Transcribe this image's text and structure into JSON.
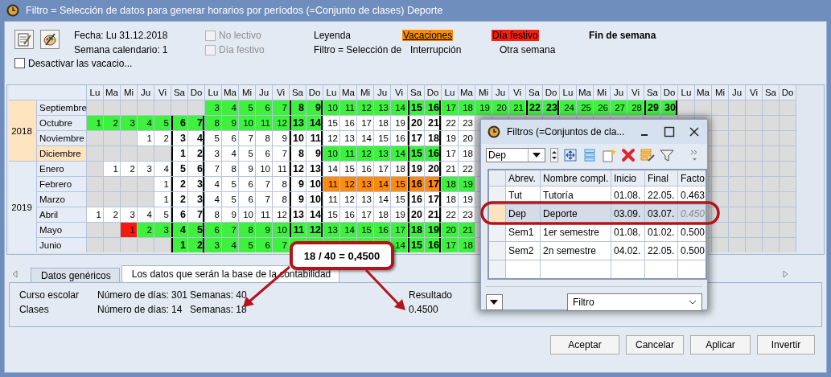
{
  "window": {
    "title": "Filtro = Selección de datos para generar horarios por períodos (=Conjunto de clases) Deporte"
  },
  "header": {
    "date_label": "Fecha:",
    "date": "Lu 31.12.2018",
    "week_label": "Semana calendario:",
    "week": "1",
    "options": [
      {
        "label": "No lectivo",
        "checked": false,
        "disabled": true
      },
      {
        "label": "Día festivo",
        "checked": false,
        "disabled": true
      }
    ],
    "legend_label": "Leyenda",
    "legend": [
      {
        "label": "Vacaciones",
        "kind": "vacation"
      },
      {
        "label": "Día festivo",
        "kind": "holiday"
      },
      {
        "label": "Fin de semana",
        "kind": "weekend"
      }
    ],
    "filter_label": "Filtro = Selección de",
    "legend_more": [
      "Interrupción",
      "Otra semana"
    ],
    "deactivate": {
      "label": "Desactivar las vacacio...",
      "checked": false
    }
  },
  "calendar": {
    "weekdays": [
      "Lu",
      "Ma",
      "Mi",
      "Ju",
      "Vi",
      "Sa",
      "Do",
      "Lu",
      "Ma",
      "Mi",
      "Ju",
      "Vi",
      "Sa",
      "Do",
      "Lu",
      "Ma",
      "Mi",
      "Ju",
      "Vi",
      "Sa",
      "Do",
      "Lu",
      "Ma",
      "Mi",
      "Ju",
      "Vi",
      "Sa",
      "Do",
      "Lu",
      "Ma",
      "Mi",
      "Ju",
      "Vi",
      "Sa",
      "Do",
      "Lu",
      "Ma",
      "Mi",
      "Ju",
      "Vi",
      "Sa",
      "Do"
    ],
    "years": [
      {
        "year": "2018",
        "selected": true,
        "months": [
          {
            "name": "Septiembre",
            "selected": false,
            "cells": [
              {
                "kind": "empty"
              },
              {
                "kind": "empty"
              },
              {
                "kind": "empty"
              },
              {
                "kind": "empty"
              },
              {
                "kind": "empty"
              },
              {
                "kind": "empty"
              },
              {
                "kind": "empty"
              },
              {
                "day": "3",
                "kind": "filter"
              },
              {
                "day": "4",
                "kind": "filter"
              },
              {
                "day": "5",
                "kind": "filter"
              },
              {
                "day": "6",
                "kind": "filter"
              },
              {
                "day": "7",
                "kind": "filter"
              },
              {
                "day": "8",
                "kind": "filter"
              },
              {
                "day": "9",
                "kind": "filter"
              },
              {
                "day": "10",
                "kind": "filter"
              },
              {
                "day": "11",
                "kind": "filter"
              },
              {
                "day": "12",
                "kind": "filter"
              },
              {
                "day": "13",
                "kind": "filter"
              },
              {
                "day": "14",
                "kind": "filter"
              },
              {
                "day": "15",
                "kind": "filter"
              },
              {
                "day": "16",
                "kind": "filter"
              },
              {
                "day": "17",
                "kind": "filter"
              },
              {
                "day": "18",
                "kind": "filter"
              },
              {
                "day": "19",
                "kind": "filter"
              },
              {
                "day": "20",
                "kind": "filter"
              },
              {
                "day": "21",
                "kind": "filter"
              },
              {
                "day": "22",
                "kind": "filter"
              },
              {
                "day": "23",
                "kind": "filter"
              },
              {
                "day": "24",
                "kind": "filter"
              },
              {
                "day": "25",
                "kind": "filter"
              },
              {
                "day": "26",
                "kind": "filter"
              },
              {
                "day": "27",
                "kind": "filter"
              },
              {
                "day": "28",
                "kind": "filter"
              },
              {
                "day": "29",
                "kind": "filter"
              },
              {
                "day": "30",
                "kind": "filter"
              },
              {
                "kind": "empty"
              },
              {
                "kind": "empty"
              },
              {
                "kind": "empty"
              },
              {
                "kind": "empty"
              },
              {
                "kind": "empty"
              },
              {
                "kind": "empty"
              },
              {
                "kind": "empty"
              }
            ]
          },
          {
            "name": "Octubre",
            "selected": false,
            "cells": [
              {
                "day": "1",
                "kind": "filter"
              },
              {
                "day": "2",
                "kind": "filter"
              },
              {
                "day": "3",
                "kind": "filter"
              },
              {
                "day": "4",
                "kind": "filter"
              },
              {
                "day": "5",
                "kind": "filter"
              },
              {
                "day": "6",
                "kind": "filter"
              },
              {
                "day": "7",
                "kind": "filter"
              },
              {
                "day": "8",
                "kind": "filter"
              },
              {
                "day": "9",
                "kind": "filter"
              },
              {
                "day": "10",
                "kind": "filter"
              },
              {
                "day": "11",
                "kind": "filter"
              },
              {
                "day": "12",
                "kind": "filter"
              },
              {
                "day": "13",
                "kind": "filter"
              },
              {
                "day": "14",
                "kind": "filter"
              },
              {
                "day": "15",
                "kind": "school"
              },
              {
                "day": "16",
                "kind": "school"
              },
              {
                "day": "17",
                "kind": "school"
              },
              {
                "day": "18",
                "kind": "school"
              },
              {
                "day": "19",
                "kind": "school"
              },
              {
                "day": "20",
                "kind": "school"
              },
              {
                "day": "21",
                "kind": "school"
              },
              {
                "day": "22",
                "kind": "school"
              },
              {
                "day": "23",
                "kind": "school"
              }
            ],
            "trailing_cells": [
              {
                "kind": "empty"
              },
              {
                "kind": "empty"
              },
              {
                "kind": "empty"
              },
              {
                "kind": "empty"
              },
              {
                "kind": "empty"
              }
            ]
          },
          {
            "name": "Noviembre",
            "selected": false,
            "cells": [
              {
                "kind": "empty"
              },
              {
                "kind": "empty"
              },
              {
                "kind": "empty"
              },
              {
                "day": "1",
                "kind": "school"
              },
              {
                "day": "2",
                "kind": "school"
              },
              {
                "day": "3",
                "kind": "school"
              },
              {
                "day": "4",
                "kind": "school"
              },
              {
                "day": "5",
                "kind": "school"
              },
              {
                "day": "6",
                "kind": "school"
              },
              {
                "day": "7",
                "kind": "school"
              },
              {
                "day": "8",
                "kind": "school"
              },
              {
                "day": "9",
                "kind": "school"
              },
              {
                "day": "10",
                "kind": "school"
              },
              {
                "day": "11",
                "kind": "school"
              },
              {
                "day": "12",
                "kind": "school"
              },
              {
                "day": "13",
                "kind": "school"
              },
              {
                "day": "14",
                "kind": "school"
              },
              {
                "day": "15",
                "kind": "school"
              },
              {
                "day": "16",
                "kind": "school"
              },
              {
                "day": "17",
                "kind": "school"
              },
              {
                "day": "18",
                "kind": "school"
              },
              {
                "day": "19",
                "kind": "school"
              },
              {
                "day": "20",
                "kind": "school"
              }
            ],
            "trailing_cells": [
              {
                "kind": "empty"
              },
              {
                "kind": "empty"
              },
              {
                "kind": "empty"
              },
              {
                "kind": "empty"
              },
              {
                "kind": "empty"
              }
            ]
          },
          {
            "name": "Diciembre",
            "selected": true,
            "cells": [
              {
                "kind": "empty"
              },
              {
                "kind": "empty"
              },
              {
                "kind": "empty"
              },
              {
                "kind": "empty"
              },
              {
                "kind": "empty"
              },
              {
                "day": "1",
                "kind": "school"
              },
              {
                "day": "2",
                "kind": "school"
              },
              {
                "day": "3",
                "kind": "school"
              },
              {
                "day": "4",
                "kind": "school"
              },
              {
                "day": "5",
                "kind": "school"
              },
              {
                "day": "6",
                "kind": "school"
              },
              {
                "day": "7",
                "kind": "school"
              },
              {
                "day": "8",
                "kind": "school"
              },
              {
                "day": "9",
                "kind": "school"
              },
              {
                "day": "10",
                "kind": "filter"
              },
              {
                "day": "11",
                "kind": "filter"
              },
              {
                "day": "12",
                "kind": "filter"
              },
              {
                "day": "13",
                "kind": "filter"
              },
              {
                "day": "14",
                "kind": "filter"
              },
              {
                "day": "15",
                "kind": "filter"
              },
              {
                "day": "16",
                "kind": "filter"
              },
              {
                "day": "17",
                "kind": "school"
              },
              {
                "day": "18",
                "kind": "school"
              }
            ],
            "trailing_cells": [
              {
                "kind": "empty"
              },
              {
                "kind": "empty"
              },
              {
                "kind": "empty"
              },
              {
                "kind": "empty"
              },
              {
                "kind": "empty"
              }
            ]
          }
        ]
      },
      {
        "year": "2019",
        "selected": false,
        "months": [
          {
            "name": "Enero",
            "selected": false,
            "cells": [
              {
                "kind": "empty"
              },
              {
                "day": "1",
                "kind": "school"
              },
              {
                "day": "2",
                "kind": "school"
              },
              {
                "day": "3",
                "kind": "school"
              },
              {
                "day": "4",
                "kind": "school"
              },
              {
                "day": "5",
                "kind": "school"
              },
              {
                "day": "6",
                "kind": "school"
              },
              {
                "day": "7",
                "kind": "school"
              },
              {
                "day": "8",
                "kind": "school"
              },
              {
                "day": "9",
                "kind": "school"
              },
              {
                "day": "10",
                "kind": "school"
              },
              {
                "day": "11",
                "kind": "school"
              },
              {
                "day": "12",
                "kind": "school"
              },
              {
                "day": "13",
                "kind": "school"
              },
              {
                "day": "14",
                "kind": "school"
              },
              {
                "day": "15",
                "kind": "school"
              },
              {
                "day": "16",
                "kind": "school"
              },
              {
                "day": "17",
                "kind": "school"
              },
              {
                "day": "18",
                "kind": "school"
              },
              {
                "day": "19",
                "kind": "school"
              },
              {
                "day": "20",
                "kind": "school"
              },
              {
                "day": "21",
                "kind": "school"
              },
              {
                "day": "22",
                "kind": "school"
              }
            ],
            "trailing_cells": [
              {
                "kind": "empty"
              },
              {
                "kind": "empty"
              },
              {
                "kind": "empty"
              },
              {
                "kind": "empty"
              },
              {
                "kind": "empty"
              }
            ]
          },
          {
            "name": "Febrero",
            "selected": false,
            "cells": [
              {
                "kind": "empty"
              },
              {
                "kind": "empty"
              },
              {
                "kind": "empty"
              },
              {
                "kind": "empty"
              },
              {
                "day": "1",
                "kind": "school"
              },
              {
                "day": "2",
                "kind": "school"
              },
              {
                "day": "3",
                "kind": "school"
              },
              {
                "day": "4",
                "kind": "school"
              },
              {
                "day": "5",
                "kind": "school"
              },
              {
                "day": "6",
                "kind": "school"
              },
              {
                "day": "7",
                "kind": "school"
              },
              {
                "day": "8",
                "kind": "school"
              },
              {
                "day": "9",
                "kind": "school"
              },
              {
                "day": "10",
                "kind": "school"
              },
              {
                "day": "11",
                "kind": "vacation"
              },
              {
                "day": "12",
                "kind": "vacation"
              },
              {
                "day": "13",
                "kind": "vacation"
              },
              {
                "day": "14",
                "kind": "vacation"
              },
              {
                "day": "15",
                "kind": "vacation"
              },
              {
                "day": "16",
                "kind": "vacation"
              },
              {
                "day": "17",
                "kind": "vacation"
              },
              {
                "day": "18",
                "kind": "filter"
              },
              {
                "day": "19",
                "kind": "filter"
              }
            ],
            "trailing_cells": [
              {
                "kind": "empty"
              },
              {
                "kind": "empty"
              },
              {
                "kind": "empty"
              },
              {
                "kind": "empty"
              },
              {
                "kind": "empty"
              }
            ]
          },
          {
            "name": "Marzo",
            "selected": false,
            "cells": [
              {
                "kind": "empty"
              },
              {
                "kind": "empty"
              },
              {
                "kind": "empty"
              },
              {
                "kind": "empty"
              },
              {
                "day": "1",
                "kind": "school"
              },
              {
                "day": "2",
                "kind": "school"
              },
              {
                "day": "3",
                "kind": "school"
              },
              {
                "day": "4",
                "kind": "school"
              },
              {
                "day": "5",
                "kind": "school"
              },
              {
                "day": "6",
                "kind": "school"
              },
              {
                "day": "7",
                "kind": "school"
              },
              {
                "day": "8",
                "kind": "school"
              },
              {
                "day": "9",
                "kind": "school"
              },
              {
                "day": "10",
                "kind": "school"
              },
              {
                "day": "11",
                "kind": "school"
              },
              {
                "day": "12",
                "kind": "school"
              },
              {
                "day": "13",
                "kind": "school"
              },
              {
                "day": "14",
                "kind": "school"
              },
              {
                "day": "15",
                "kind": "school"
              },
              {
                "day": "16",
                "kind": "school"
              },
              {
                "day": "17",
                "kind": "school"
              },
              {
                "day": "18",
                "kind": "school"
              },
              {
                "day": "19",
                "kind": "school"
              }
            ],
            "trailing_cells": [
              {
                "kind": "empty"
              },
              {
                "kind": "empty"
              },
              {
                "kind": "empty"
              },
              {
                "kind": "empty"
              },
              {
                "kind": "empty"
              }
            ]
          },
          {
            "name": "Abril",
            "selected": false,
            "cells": [
              {
                "day": "1",
                "kind": "school"
              },
              {
                "day": "2",
                "kind": "school"
              },
              {
                "day": "3",
                "kind": "school"
              },
              {
                "day": "4",
                "kind": "school"
              },
              {
                "day": "5",
                "kind": "school"
              },
              {
                "day": "6",
                "kind": "school"
              },
              {
                "day": "7",
                "kind": "school"
              },
              {
                "day": "8",
                "kind": "school"
              },
              {
                "day": "9",
                "kind": "school"
              },
              {
                "day": "10",
                "kind": "school"
              },
              {
                "day": "11",
                "kind": "school"
              },
              {
                "day": "12",
                "kind": "school"
              },
              {
                "day": "13",
                "kind": "school"
              },
              {
                "day": "14",
                "kind": "school"
              },
              {
                "day": "15",
                "kind": "school"
              },
              {
                "day": "16",
                "kind": "school"
              },
              {
                "day": "17",
                "kind": "school"
              },
              {
                "day": "18",
                "kind": "school"
              },
              {
                "day": "19",
                "kind": "school"
              },
              {
                "day": "20",
                "kind": "school"
              },
              {
                "day": "21",
                "kind": "school"
              },
              {
                "day": "22",
                "kind": "school"
              },
              {
                "day": "23",
                "kind": "school"
              }
            ],
            "trailing_cells": [
              {
                "kind": "empty"
              },
              {
                "kind": "empty"
              },
              {
                "kind": "empty"
              },
              {
                "kind": "empty"
              },
              {
                "kind": "empty"
              }
            ]
          },
          {
            "name": "Mayo",
            "selected": false,
            "cells": [
              {
                "kind": "empty"
              },
              {
                "kind": "empty"
              },
              {
                "day": "1",
                "kind": "holiday"
              },
              {
                "day": "2",
                "kind": "filter"
              },
              {
                "day": "3",
                "kind": "filter"
              },
              {
                "day": "4",
                "kind": "filter"
              },
              {
                "day": "5",
                "kind": "filter"
              },
              {
                "day": "6",
                "kind": "filter"
              },
              {
                "day": "7",
                "kind": "filter"
              },
              {
                "day": "8",
                "kind": "filter"
              },
              {
                "day": "9",
                "kind": "filter"
              },
              {
                "day": "10",
                "kind": "filter"
              },
              {
                "day": "11",
                "kind": "filter"
              },
              {
                "day": "12",
                "kind": "filter"
              },
              {
                "day": "13",
                "kind": "filter"
              },
              {
                "day": "14",
                "kind": "filter"
              },
              {
                "day": "15",
                "kind": "filter"
              },
              {
                "day": "16",
                "kind": "filter"
              },
              {
                "day": "17",
                "kind": "filter"
              },
              {
                "day": "18",
                "kind": "filter"
              },
              {
                "day": "19",
                "kind": "filter"
              },
              {
                "day": "20",
                "kind": "filter"
              },
              {
                "day": "21",
                "kind": "filter"
              }
            ],
            "trailing_cells": [
              {
                "kind": "empty"
              },
              {
                "kind": "empty"
              },
              {
                "kind": "empty"
              },
              {
                "kind": "empty"
              },
              {
                "kind": "empty"
              }
            ]
          },
          {
            "name": "Junio",
            "selected": false,
            "cells": [
              {
                "kind": "empty"
              },
              {
                "kind": "empty"
              },
              {
                "kind": "empty"
              },
              {
                "kind": "empty"
              },
              {
                "kind": "empty"
              },
              {
                "day": "1",
                "kind": "filter"
              },
              {
                "day": "2",
                "kind": "filter"
              },
              {
                "day": "3",
                "kind": "filter"
              },
              {
                "day": "4",
                "kind": "filter"
              },
              {
                "day": "5",
                "kind": "filter"
              },
              {
                "day": "6",
                "kind": "filter"
              },
              {
                "day": "7",
                "kind": "filter"
              },
              {
                "kind": "filter"
              },
              {
                "kind": "filter"
              },
              {
                "kind": "filter"
              },
              {
                "kind": "filter"
              },
              {
                "kind": "filter"
              },
              {
                "kind": "filter"
              },
              {
                "day": "14",
                "kind": "filter"
              },
              {
                "day": "15",
                "kind": "filter"
              },
              {
                "day": "16",
                "kind": "filter"
              },
              {
                "day": "17",
                "kind": "filter"
              },
              {
                "day": "18",
                "kind": "filter"
              }
            ],
            "trailing_cells": [
              {
                "kind": "empty"
              },
              {
                "kind": "empty"
              },
              {
                "kind": "empty"
              },
              {
                "kind": "empty"
              },
              {
                "kind": "empty"
              }
            ]
          }
        ]
      }
    ]
  },
  "tabs": [
    {
      "label": "Datos genéricos",
      "selected": false
    },
    {
      "label": "Los datos que serán la base de la contabilidad",
      "selected": true
    }
  ],
  "summary": {
    "rows": [
      {
        "label": "Curso escolar",
        "days_label": "Número de días:",
        "days": "301",
        "weeks": "Semanas: 40"
      },
      {
        "label": "Clases",
        "days_label": "Número de días:",
        "days": "14",
        "weeks": "Semanas: 18"
      }
    ],
    "result_label": "Resultado",
    "result": "0.4500"
  },
  "buttons": [
    "Aceptar",
    "Cancelar",
    "Aplicar",
    "Invertir"
  ],
  "callout": "18 / 40 = 0,4500",
  "filters_window": {
    "title": "Filtros (=Conjuntos de cla...",
    "selector": "Dep",
    "columns": [
      "Abrev.",
      "Nombre compl.",
      "Inicio",
      "Final",
      "Facto"
    ],
    "rows": [
      {
        "cells": [
          "Tut",
          "Tutoría",
          "01.08.",
          "22.05.",
          "0.463"
        ],
        "selected": false
      },
      {
        "cells": [
          "Dep",
          "Deporte",
          "03.09.",
          "03.07.",
          "0.450"
        ],
        "selected": true
      },
      {
        "cells": [
          "Sem1",
          "1er semestre",
          "01.08.",
          "01.02.",
          "0.500"
        ],
        "selected": false
      },
      {
        "cells": [
          "Sem2",
          "2n semestre",
          "04.02.",
          "22.05.",
          "0.500"
        ],
        "selected": false
      }
    ],
    "bottom_selector": "Filtro"
  }
}
